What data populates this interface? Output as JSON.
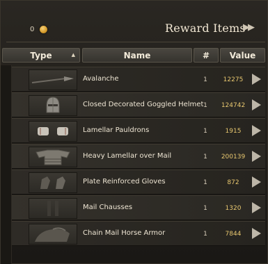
{
  "header": {
    "gold_count": "0",
    "title": "Reward Items",
    "arrow": "▶▶"
  },
  "columns": {
    "type": "Type",
    "name": "Name",
    "num": "#",
    "value": "Value",
    "sort_indicator": "▲"
  },
  "items": [
    {
      "name": "Avalanche",
      "count": "1",
      "value": "12275",
      "icon": "polearm-icon"
    },
    {
      "name": "Closed Decorated Goggled Helmet",
      "count": "1",
      "value": "124742",
      "icon": "helmet-icon"
    },
    {
      "name": "Lamellar Pauldrons",
      "count": "1",
      "value": "1915",
      "icon": "pauldrons-icon"
    },
    {
      "name": "Heavy Lamellar over Mail",
      "count": "1",
      "value": "200139",
      "icon": "body-armor-icon"
    },
    {
      "name": "Plate Reinforced Gloves",
      "count": "1",
      "value": "872",
      "icon": "gloves-icon"
    },
    {
      "name": "Mail Chausses",
      "count": "1",
      "value": "1320",
      "icon": "boots-icon"
    },
    {
      "name": "Chain Mail Horse Armor",
      "count": "1",
      "value": "7844",
      "icon": "horse-armor-icon"
    }
  ],
  "colors": {
    "value_text": "#e9c870",
    "panel_bg": "#1f1d19"
  }
}
